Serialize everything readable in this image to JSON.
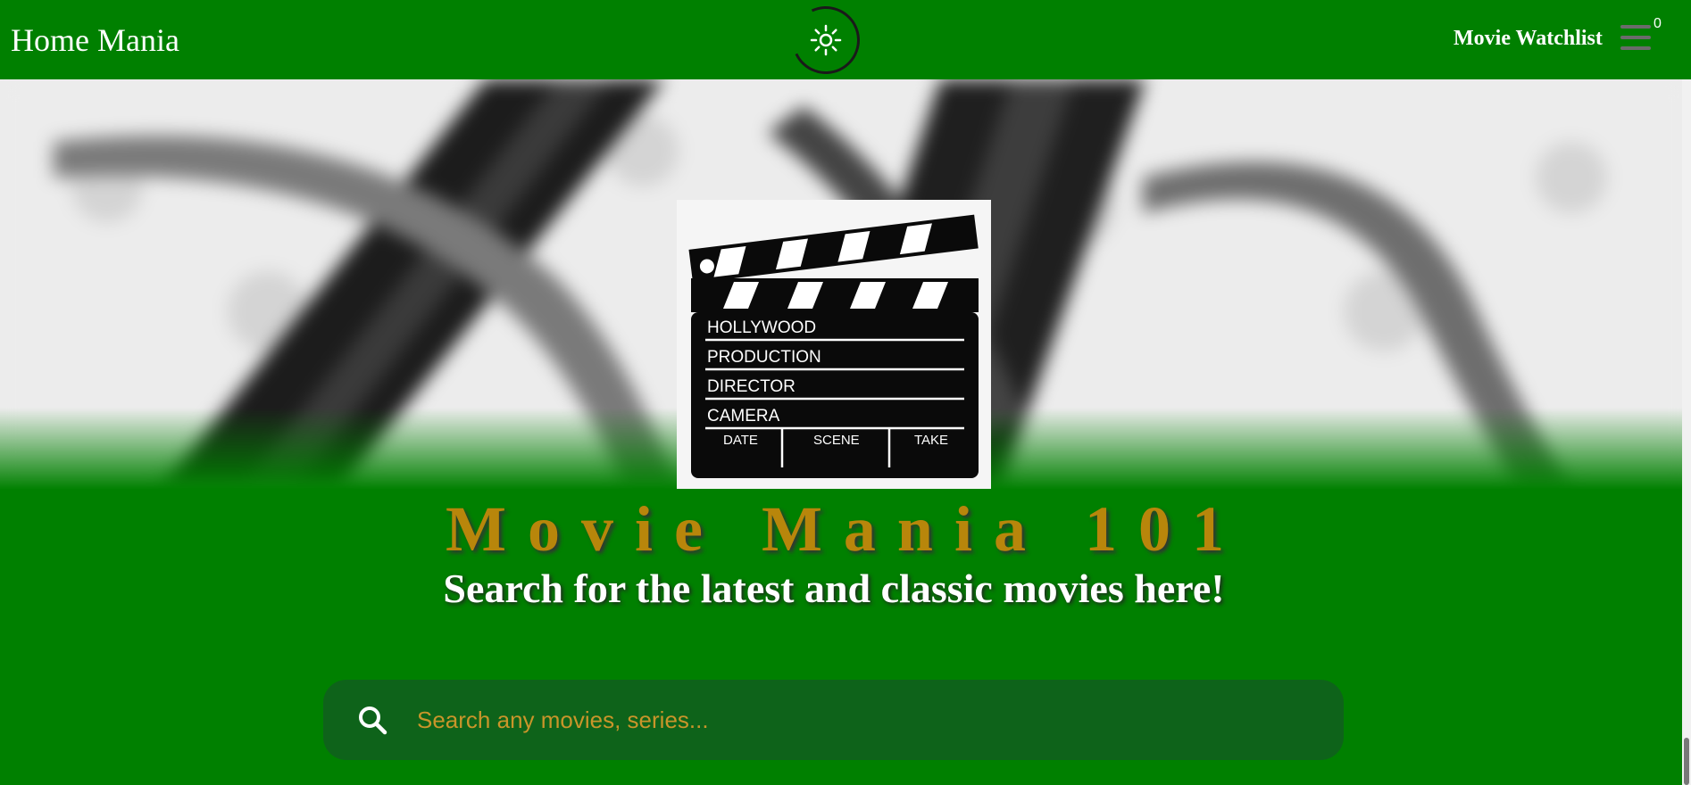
{
  "nav": {
    "brand": "Home Mania",
    "watchlist_label": "Movie Watchlist",
    "watchlist_count": "0"
  },
  "hero": {
    "clapperboard": {
      "lines": [
        "HOLLYWOOD",
        "PRODUCTION",
        "DIRECTOR",
        "CAMERA"
      ],
      "columns": [
        "DATE",
        "SCENE",
        "TAKE"
      ]
    },
    "title": "Movie Mania 101",
    "subtitle": "Search for the latest and classic movies here!"
  },
  "search": {
    "placeholder": "Search any movies, series..."
  },
  "colors": {
    "background": "#008000",
    "title_gold": "#b8860b",
    "search_bar": "#0e631a",
    "placeholder": "#c9952a"
  },
  "icons": {
    "theme": "sun-icon",
    "menu": "hamburger-icon",
    "search": "search-icon"
  }
}
